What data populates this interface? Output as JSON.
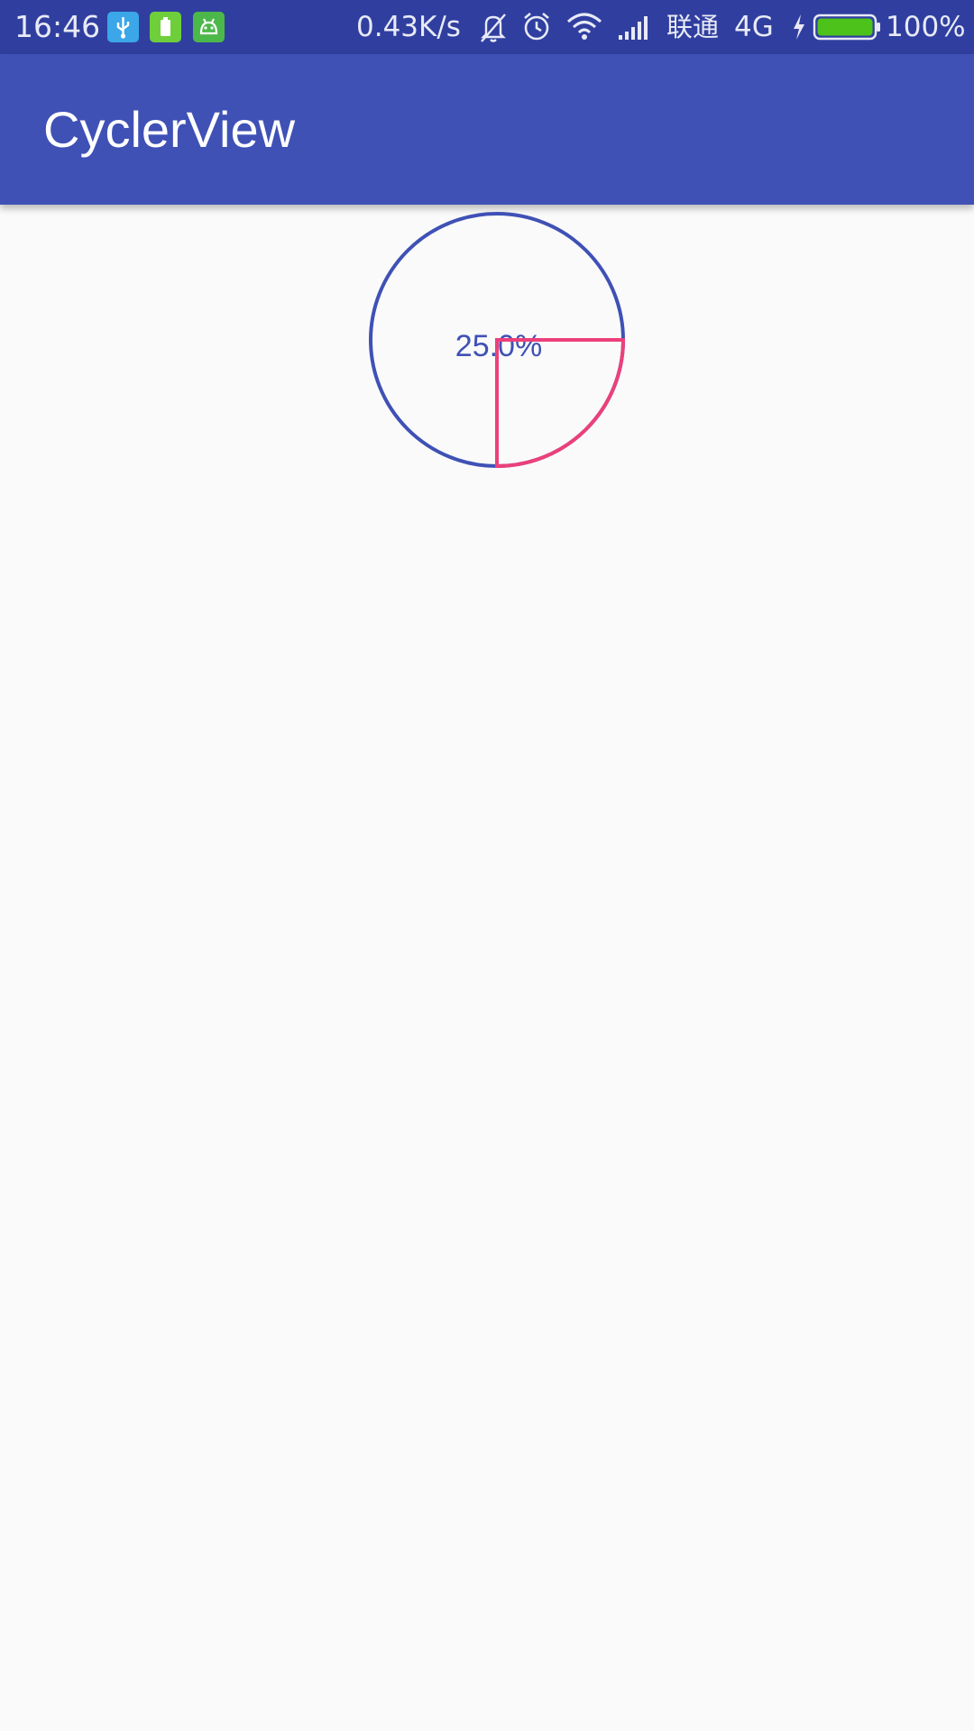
{
  "status_bar": {
    "time": "16:46",
    "notification_icons": [
      "usb-icon",
      "battery-saver-icon",
      "android-icon"
    ],
    "net_speed": "0.43K/s",
    "status_icons": [
      "bell-off-icon",
      "alarm-clock-icon",
      "wifi-icon",
      "signal-icon"
    ],
    "carrier": "联通",
    "network_type": "4G",
    "battery_percent": "100%",
    "battery_level": 1.0,
    "charging": true
  },
  "app_bar": {
    "title": "CyclerView",
    "color": "#3f51b5"
  },
  "cycler_view": {
    "progress_label": "25.0%",
    "progress": 0.25,
    "circle_color": "#3f51b5",
    "progress_color": "#ec407a"
  }
}
